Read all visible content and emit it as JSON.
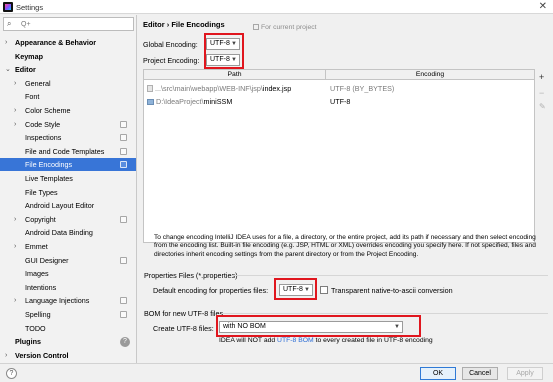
{
  "window": {
    "title": "Settings",
    "close_glyph": "✕"
  },
  "icons": {
    "app": "intellij-app-icon",
    "search": "search-icon",
    "help": "help-icon",
    "project": "project-scope-icon"
  },
  "sidebar": {
    "search_placeholder": "Q+",
    "items": [
      {
        "label": "Appearance & Behavior",
        "arrow": "›",
        "bold": true
      },
      {
        "label": "Keymap",
        "arrow": "",
        "bold": true
      },
      {
        "label": "Editor",
        "arrow": "⌄",
        "bold": true
      },
      {
        "label": "General",
        "arrow": "›"
      },
      {
        "label": "Font",
        "arrow": ""
      },
      {
        "label": "Color Scheme",
        "arrow": "›"
      },
      {
        "label": "Code Style",
        "arrow": "›",
        "proj": true
      },
      {
        "label": "Inspections",
        "arrow": "",
        "proj": true
      },
      {
        "label": "File and Code Templates",
        "arrow": "",
        "proj": true
      },
      {
        "label": "File Encodings",
        "arrow": "",
        "proj": true,
        "selected": true
      },
      {
        "label": "Live Templates",
        "arrow": ""
      },
      {
        "label": "File Types",
        "arrow": ""
      },
      {
        "label": "Android Layout Editor",
        "arrow": ""
      },
      {
        "label": "Copyright",
        "arrow": "›",
        "proj": true
      },
      {
        "label": "Android Data Binding",
        "arrow": ""
      },
      {
        "label": "Emmet",
        "arrow": "›"
      },
      {
        "label": "GUI Designer",
        "arrow": "",
        "proj": true
      },
      {
        "label": "Images",
        "arrow": ""
      },
      {
        "label": "Intentions",
        "arrow": ""
      },
      {
        "label": "Language Injections",
        "arrow": "›",
        "proj": true
      },
      {
        "label": "Spelling",
        "arrow": "",
        "proj": true
      },
      {
        "label": "TODO",
        "arrow": ""
      },
      {
        "label": "Plugins",
        "arrow": "",
        "bold": true
      },
      {
        "label": "Version Control",
        "arrow": "›",
        "bold": true
      }
    ]
  },
  "content": {
    "breadcrumb": "Editor  ›  File Encodings",
    "for_project": "For current project",
    "global_label": "Global Encoding:",
    "global_value": "UTF-8",
    "project_label": "Project Encoding:",
    "project_value": "UTF-8",
    "table": {
      "headers": [
        "Path",
        "Encoding"
      ],
      "rows": [
        {
          "path_prefix": "...\\src\\main\\webapp\\WEB-INF\\jsp\\",
          "path_name": "index.jsp",
          "encoding": "UTF-8 (BY_BYTES)",
          "encoding_grey": true,
          "kind": "file"
        },
        {
          "path_prefix": "D:\\IdeaProject\\",
          "path_name": "miniSSM",
          "encoding": "UTF-8",
          "encoding_grey": false,
          "kind": "folder"
        }
      ]
    },
    "table_tools": {
      "add": "+",
      "remove": "−",
      "edit": "✎"
    },
    "description": "To change encoding IntelliJ IDEA uses for a file, a directory, or the entire project, add its path if necessary and then select encoding from the encoding list. Built-in file encoding (e.g. JSP, HTML or XML) overrides encoding you specify here. If not specified, files and directories inherit encoding settings from the parent directory or from the Project Encoding.",
    "properties_section": "Properties Files (*.properties)",
    "properties_label": "Default encoding for properties files:",
    "properties_value": "UTF-8",
    "native_ascii_label": "Transparent native-to-ascii conversion",
    "bom_section": "BOM for new UTF-8 files",
    "bom_label": "Create UTF-8 files:",
    "bom_value": "with NO BOM",
    "bom_note_pre": "IDEA will NOT add ",
    "bom_note_link": "UTF-8 BOM",
    "bom_note_post": " to every created file in UTF-8 encoding"
  },
  "footer": {
    "ok": "OK",
    "cancel": "Cancel",
    "apply": "Apply",
    "help_glyph": "?"
  },
  "colors": {
    "selection": "#3875d7",
    "highlight_box": "#e0161e",
    "link": "#2a6cd6"
  }
}
